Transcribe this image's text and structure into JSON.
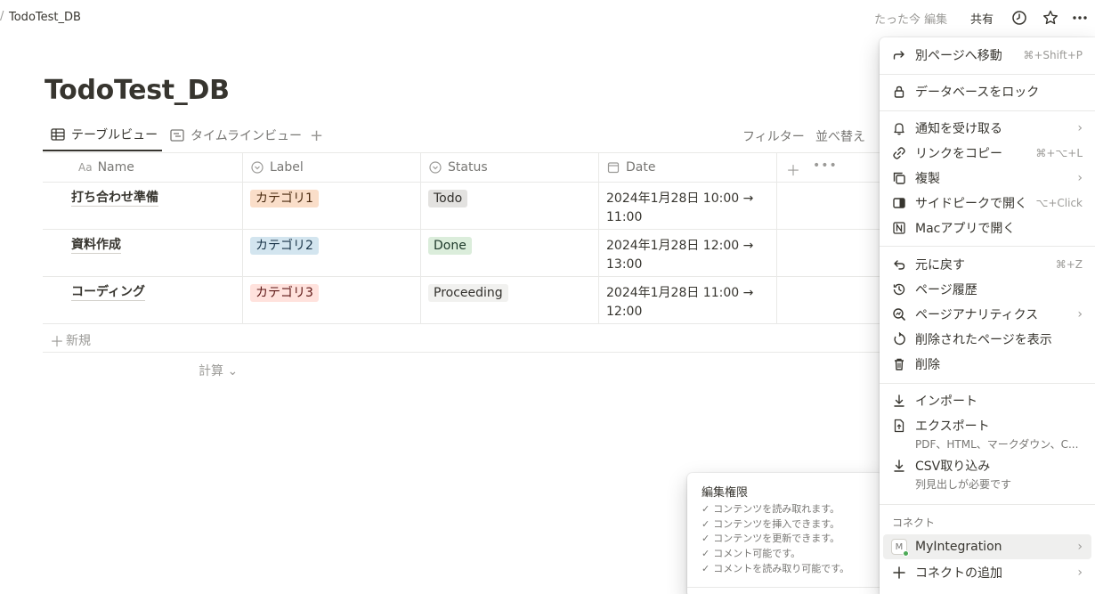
{
  "topbar": {
    "breadcrumb_slash": "/",
    "breadcrumb_title": "TodoTest_DB",
    "edited": "たった今 編集",
    "share": "共有"
  },
  "page": {
    "title": "TodoTest_DB"
  },
  "views": {
    "tabs": [
      {
        "label": "テーブルビュー",
        "icon": "table-icon"
      },
      {
        "label": "タイムラインビュー",
        "icon": "timeline-icon"
      }
    ],
    "add": "+",
    "filter": "フィルター",
    "sort": "並べ替え"
  },
  "table": {
    "headers": [
      {
        "label": "Name",
        "icon_text": "Aa"
      },
      {
        "label": "Label",
        "icon": "select-icon"
      },
      {
        "label": "Status",
        "icon": "select-icon"
      },
      {
        "label": "Date",
        "icon": "calendar-icon"
      }
    ],
    "rows": [
      {
        "name": "打ち合わせ準備",
        "label": "カテゴリ1",
        "status": "Todo",
        "date": "2024年1月28日 10:00 → 11:00"
      },
      {
        "name": "資料作成",
        "label": "カテゴリ2",
        "status": "Done",
        "date": "2024年1月28日 12:00 → 13:00"
      },
      {
        "name": "コーディング",
        "label": "カテゴリ3",
        "status": "Proceeding",
        "date": "2024年1月28日 11:00 → 12:00"
      }
    ],
    "new_row": "新規",
    "calc": "計算 ⌄"
  },
  "menu": {
    "move": {
      "label": "別ページへ移動",
      "shortcut": "⌘+Shift+P"
    },
    "lock": {
      "label": "データベースをロック"
    },
    "notify": {
      "label": "通知を受け取る"
    },
    "copy_link": {
      "label": "リンクをコピー",
      "shortcut": "⌘+⌥+L"
    },
    "duplicate": {
      "label": "複製"
    },
    "side_peek": {
      "label": "サイドピークで開く",
      "shortcut": "⌥+Click"
    },
    "mac_app": {
      "label": "Macアプリで開く"
    },
    "undo": {
      "label": "元に戻す",
      "shortcut": "⌘+Z"
    },
    "history": {
      "label": "ページ履歴"
    },
    "analytics": {
      "label": "ページアナリティクス"
    },
    "show_deleted": {
      "label": "削除されたページを表示"
    },
    "delete": {
      "label": "削除"
    },
    "import": {
      "label": "インポート"
    },
    "export": {
      "label": "エクスポート",
      "sub": "PDF、HTML、マークダウン、C..."
    },
    "csv": {
      "label": "CSV取り込み",
      "sub": "列見出しが必要です"
    },
    "connect_section": "コネクト",
    "integration": {
      "label": "MyIntegration",
      "avatar": "M"
    },
    "add_connect": {
      "label": "コネクトの追加"
    }
  },
  "permission": {
    "title": "編集権限",
    "items": [
      "コンテンツを読み取れます。",
      "コンテンツを挿入できます。",
      "コンテンツを更新できます。",
      "コメント可能です。",
      "コメントを読み取り可能です。"
    ]
  },
  "colors": {
    "text": "#37352f",
    "muted": "#9b9a97",
    "tag_orange": "#fadec9",
    "tag_blue": "#d3e5ef",
    "tag_red": "#ffe2dd",
    "tag_gray": "#e3e2e0",
    "tag_green": "#dbeddb"
  }
}
